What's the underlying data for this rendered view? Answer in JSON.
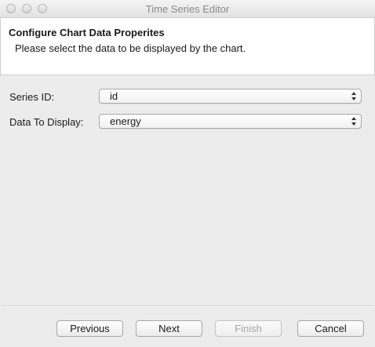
{
  "window": {
    "title": "Time Series Editor"
  },
  "header": {
    "title": "Configure Chart Data Properites",
    "subtitle": "Please select the data to be displayed by the chart."
  },
  "form": {
    "series_id_label": "Series ID:",
    "series_id_value": "id",
    "data_label": "Data To Display:",
    "data_value": "energy"
  },
  "buttons": {
    "previous": "Previous",
    "next": "Next",
    "finish": "Finish",
    "cancel": "Cancel"
  }
}
